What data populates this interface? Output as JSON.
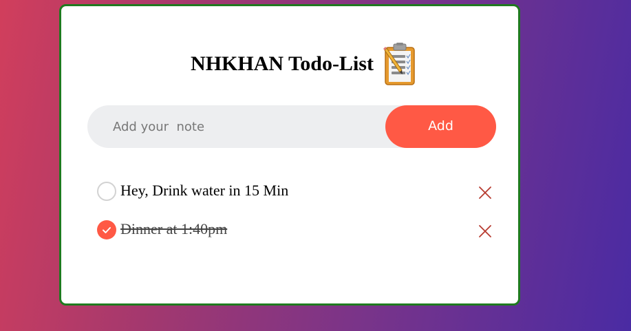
{
  "app": {
    "title": "NHKHAN Todo-List",
    "icon": "clipboard-checklist-icon"
  },
  "input": {
    "placeholder": "Add your  note",
    "value": ""
  },
  "add_button": {
    "label": "Add"
  },
  "todos": [
    {
      "text": "Hey, Drink water in 15 Min",
      "completed": false
    },
    {
      "text": "Dinner at 1:40pm",
      "completed": true
    }
  ],
  "colors": {
    "accent": "#ff5945",
    "card_border": "#1f7a1f",
    "delete": "#b73a2f"
  }
}
